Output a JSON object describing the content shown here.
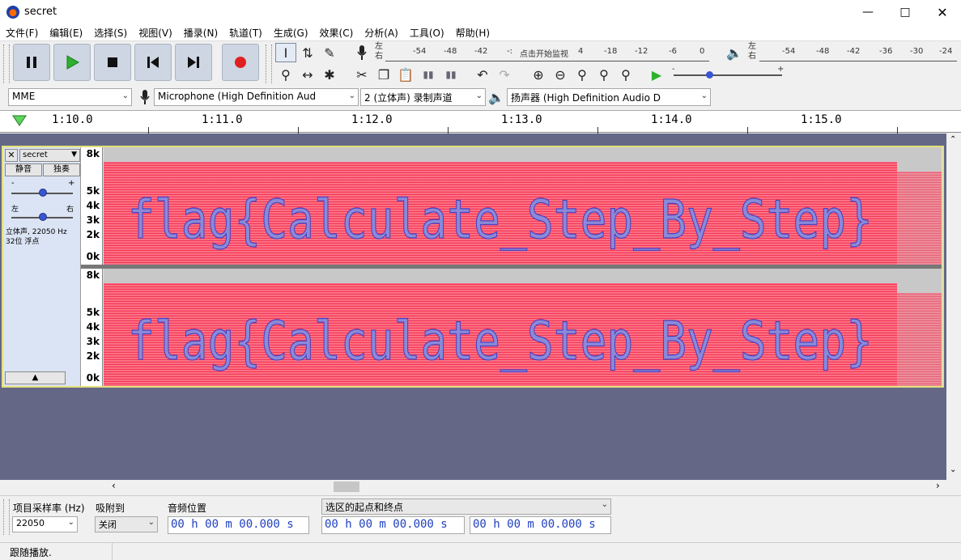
{
  "window": {
    "title": "secret"
  },
  "menu": [
    "文件(F)",
    "编辑(E)",
    "选择(S)",
    "视图(V)",
    "播录(N)",
    "轨道(T)",
    "生成(G)",
    "效果(C)",
    "分析(A)",
    "工具(O)",
    "帮助(H)"
  ],
  "meters": {
    "rec_lr": [
      "左",
      "右"
    ],
    "rec_ticks": [
      "-54",
      "-48",
      "-42",
      "-:",
      "4",
      "-18",
      "-12",
      "-6",
      "0"
    ],
    "rec_prompt": "点击开始监视",
    "play_lr": [
      "左",
      "右"
    ],
    "play_ticks": [
      "-54",
      "-48",
      "-42",
      "-36",
      "-30",
      "-24"
    ],
    "play_speed_minus": "-",
    "play_speed_plus": "+"
  },
  "device": {
    "host": "MME",
    "mic": "Microphone (High Definition Aud",
    "channels": "2 (立体声) 录制声道",
    "speaker": "扬声器 (High Definition Audio D"
  },
  "ruler": [
    "1:10.0",
    "1:11.0",
    "1:12.0",
    "1:13.0",
    "1:14.0",
    "1:15.0"
  ],
  "track": {
    "name": "secret",
    "mute": "静音",
    "solo": "独奏",
    "gain_minus": "-",
    "gain_plus": "+",
    "pan_left": "左",
    "pan_right": "右",
    "info1": "立体声, 22050 Hz",
    "info2": "32位 浮点",
    "freq_labels": [
      "8k",
      "5k",
      "4k",
      "3k",
      "2k",
      "0k"
    ],
    "spectrogram_text": "flag{Calculate_Step_By_Step}"
  },
  "selection": {
    "rate_label": "项目采样率 (Hz)",
    "rate_value": "22050",
    "snap_label": "吸附到",
    "snap_value": "关闭",
    "pos_label": "音频位置",
    "pos_value": "00 h 00 m 00.000 s",
    "range_label": "选区的起点和终点",
    "start_value": "00 h 00 m 00.000 s",
    "end_value": "00 h 00 m 00.000 s"
  },
  "status": "跟随播放."
}
